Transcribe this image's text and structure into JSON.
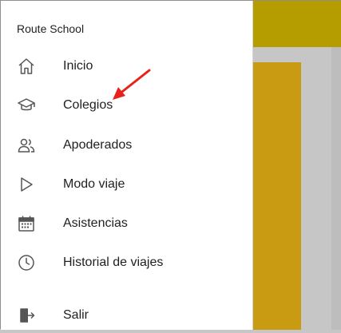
{
  "app": {
    "title": "Route School"
  },
  "menu": {
    "items": [
      {
        "label": "Inicio",
        "icon": "home-icon"
      },
      {
        "label": "Colegios",
        "icon": "school-icon"
      },
      {
        "label": "Apoderados",
        "icon": "people-icon"
      },
      {
        "label": "Modo viaje",
        "icon": "play-icon"
      },
      {
        "label": "Asistencias",
        "icon": "calendar-icon"
      },
      {
        "label": "Historial de viajes",
        "icon": "clock-icon"
      }
    ],
    "logout": {
      "label": "Salir",
      "icon": "logout-icon"
    }
  },
  "colors": {
    "appbar": "#b59d00",
    "accent_card": "#c99b12",
    "annotation_arrow": "#e8221b",
    "icon": "#555555"
  }
}
